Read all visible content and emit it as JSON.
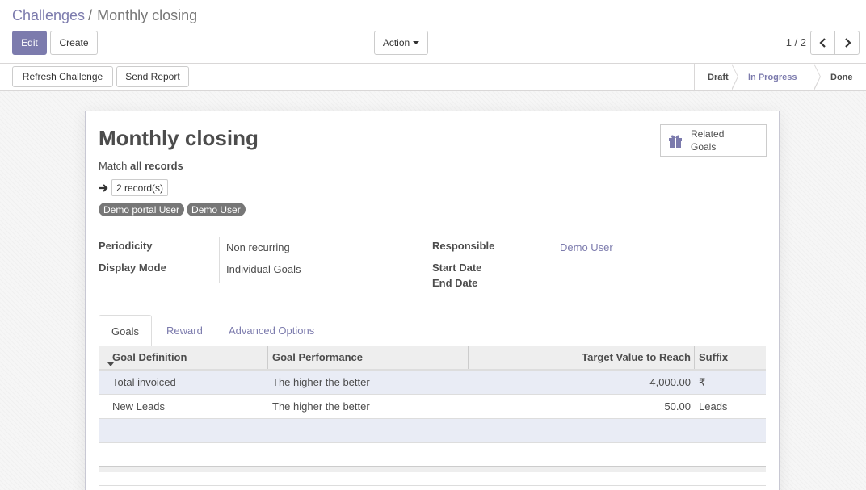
{
  "breadcrumb": {
    "parent": "Challenges",
    "separator": "/",
    "current": "Monthly closing"
  },
  "toolbar": {
    "edit_label": "Edit",
    "create_label": "Create",
    "action_label": "Action"
  },
  "pager": {
    "value": "1 / 2"
  },
  "header_buttons": {
    "refresh_label": "Refresh Challenge",
    "send_report_label": "Send Report"
  },
  "statusbar": {
    "stages": [
      "Draft",
      "In Progress",
      "Done"
    ],
    "active": "In Progress"
  },
  "form": {
    "title": "Monthly closing",
    "smart_button": {
      "label_line1": "Related",
      "label_line2": "Goals",
      "icon": "gift-icon"
    },
    "domain": {
      "prefix": "Match",
      "value": "all records"
    },
    "records_label": "2 record(s)",
    "users": [
      "Demo portal User",
      "Demo User"
    ],
    "fields_left": [
      {
        "label": "Periodicity",
        "value": "Non recurring"
      },
      {
        "label": "Display Mode",
        "value": "Individual Goals"
      }
    ],
    "fields_right": {
      "responsible_label": "Responsible",
      "responsible_value": "Demo User",
      "start_label": "Start Date",
      "end_label": "End Date"
    }
  },
  "tabs": [
    "Goals",
    "Reward",
    "Advanced Options"
  ],
  "goals_table": {
    "headers": [
      "Goal Definition",
      "Goal Performance",
      "Target Value to Reach",
      "Suffix"
    ],
    "rows": [
      [
        "Total invoiced",
        "The higher the better",
        "4,000.00",
        "₹"
      ],
      [
        "New Leads",
        "The higher the better",
        "50.00",
        "Leads"
      ]
    ]
  },
  "colors": {
    "accent": "#7c7bad",
    "text": "#4c4c4c",
    "tag_bg": "#777777",
    "row_highlight": "#e9ecf5"
  }
}
